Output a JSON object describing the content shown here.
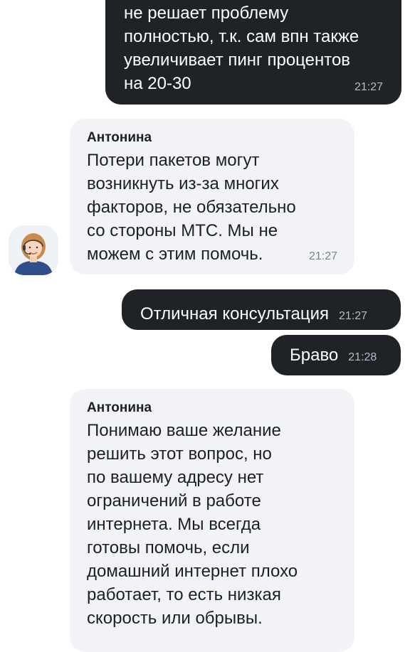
{
  "messages": [
    {
      "direction": "outgoing",
      "text": "не решает проблему\nполностью, т.к. сам впн также\nувеличивает пинг процентов\nна 20-30",
      "time": "21:27"
    },
    {
      "direction": "incoming",
      "sender": "Антонина",
      "text": "Потери пакетов могут\nвозникнуть из-за многих\nфакторов, не обязательно\nсо стороны МТС. Мы не\nможем с этим помочь.",
      "time": "21:27"
    },
    {
      "direction": "outgoing",
      "text": "Отличная консультация",
      "time": "21:27"
    },
    {
      "direction": "outgoing",
      "text": "Браво",
      "time": "21:28"
    },
    {
      "direction": "incoming",
      "sender": "Антонина",
      "text": "Понимаю ваше желание\nрешить этот вопрос, но\nпо вашему адресу нет\nограничений в работе\nинтернета. Мы всегда\nготовы помочь, если\nдомашний интернет плохо\nработает, то есть низкая\nскорость или обрывы."
    }
  ],
  "colors": {
    "outgoing_bubble": "#1f2227",
    "incoming_bubble": "#f1f3f7",
    "outgoing_text": "#ffffff",
    "incoming_text": "#1d2023"
  },
  "avatar": {
    "icon": "support-operator-avatar"
  }
}
